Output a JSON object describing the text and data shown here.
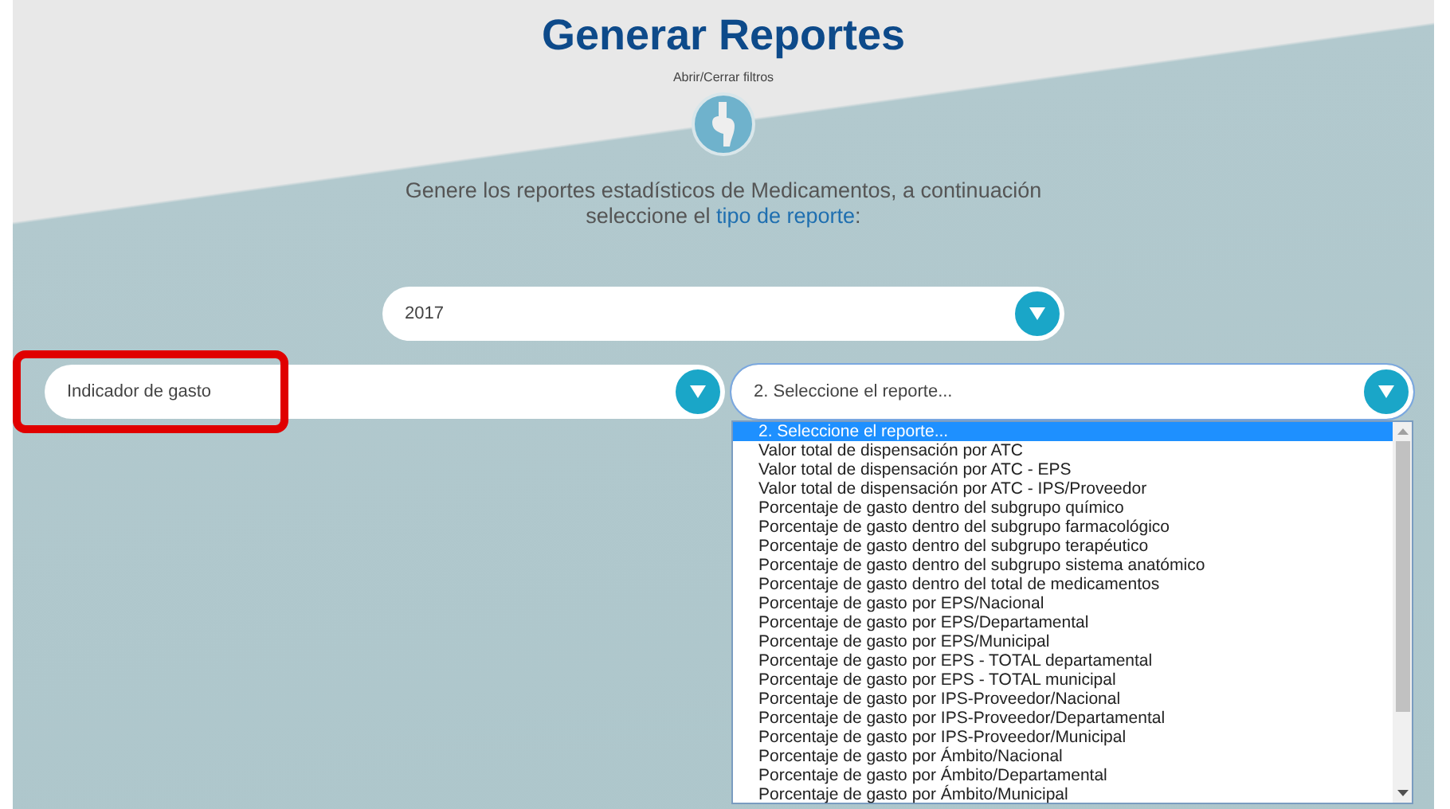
{
  "title": "Generar Reportes",
  "toggle_label": "Abrir/Cerrar filtros",
  "description": {
    "text": "Genere los reportes estadísticos de Medicamentos, a continuación seleccione el",
    "link": "tipo de reporte",
    "suffix": ":"
  },
  "year_select": {
    "value": "2017"
  },
  "type_select": {
    "value": "Indicador de gasto",
    "highlighted": true
  },
  "report_select": {
    "value": "2. Seleccione el reporte...",
    "expanded": true,
    "options": [
      {
        "label": "2. Seleccione el reporte...",
        "selected": true
      },
      {
        "label": "Valor total de dispensación por ATC",
        "selected": false
      },
      {
        "label": "Valor total de dispensación por ATC - EPS",
        "selected": false
      },
      {
        "label": "Valor total de dispensación por ATC - IPS/Proveedor",
        "selected": false
      },
      {
        "label": "Porcentaje de gasto dentro del subgrupo químico",
        "selected": false
      },
      {
        "label": "Porcentaje de gasto dentro del subgrupo farmacológico",
        "selected": false
      },
      {
        "label": "Porcentaje de gasto dentro del subgrupo terapéutico",
        "selected": false
      },
      {
        "label": "Porcentaje de gasto dentro del subgrupo sistema anatómico",
        "selected": false
      },
      {
        "label": "Porcentaje de gasto dentro del total de medicamentos",
        "selected": false
      },
      {
        "label": "Porcentaje de gasto por EPS/Nacional",
        "selected": false
      },
      {
        "label": "Porcentaje de gasto por EPS/Departamental",
        "selected": false
      },
      {
        "label": "Porcentaje de gasto por EPS/Municipal",
        "selected": false
      },
      {
        "label": "Porcentaje de gasto por EPS - TOTAL departamental",
        "selected": false
      },
      {
        "label": "Porcentaje de gasto por EPS - TOTAL municipal",
        "selected": false
      },
      {
        "label": "Porcentaje de gasto por IPS-Proveedor/Nacional",
        "selected": false
      },
      {
        "label": "Porcentaje de gasto por IPS-Proveedor/Departamental",
        "selected": false
      },
      {
        "label": "Porcentaje de gasto por IPS-Proveedor/Municipal",
        "selected": false
      },
      {
        "label": "Porcentaje de gasto por Ámbito/Nacional",
        "selected": false
      },
      {
        "label": "Porcentaje de gasto por Ámbito/Departamental",
        "selected": false
      },
      {
        "label": "Porcentaje de gasto por Ámbito/Municipal",
        "selected": false
      }
    ]
  }
}
